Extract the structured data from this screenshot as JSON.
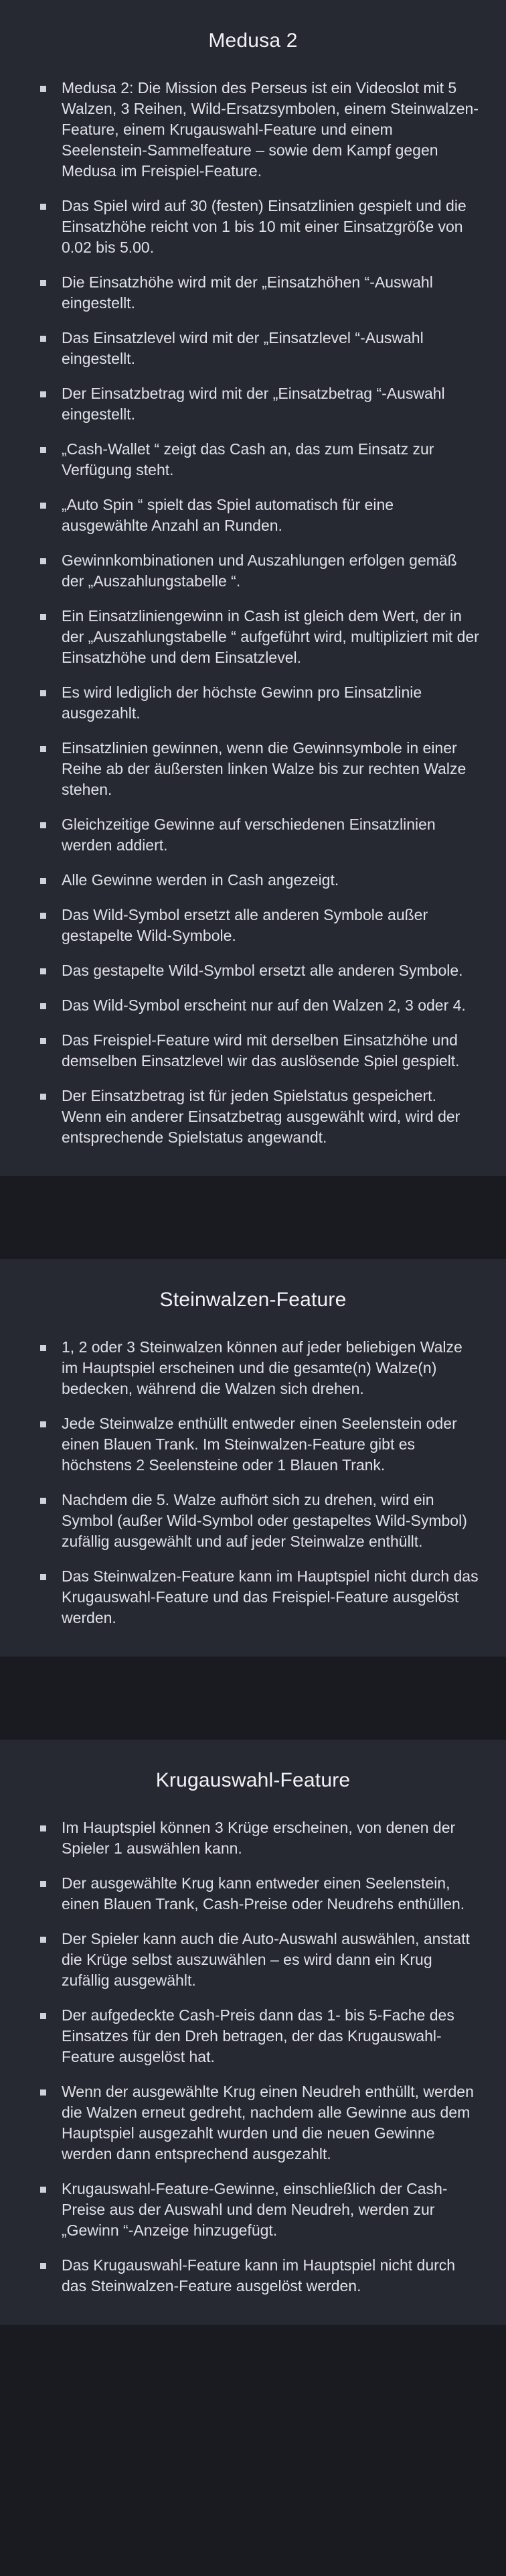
{
  "sections": [
    {
      "title": "Medusa 2",
      "items": [
        "Medusa 2: Die Mission des Perseus ist ein Videoslot mit 5 Walzen, 3 Reihen, Wild-Ersatzsymbolen, einem Steinwalzen-Feature, einem Krugauswahl-Feature und einem Seelenstein-Sammelfeature – sowie dem Kampf gegen Medusa im Freispiel-Feature.",
        "Das Spiel wird auf 30 (festen) Einsatzlinien gespielt und die Einsatzhöhe reicht von 1 bis 10 mit einer Einsatzgröße von 0.02 bis 5.00.",
        "Die Einsatzhöhe wird mit der „Einsatzhöhen “-Auswahl eingestellt.",
        "Das Einsatzlevel wird mit der „Einsatzlevel “-Auswahl eingestellt.",
        "Der Einsatzbetrag wird mit der „Einsatzbetrag “-Auswahl eingestellt.",
        "„Cash-Wallet “ zeigt das Cash an, das zum Einsatz zur Verfügung steht.",
        "„Auto Spin “ spielt das Spiel automatisch für eine ausgewählte Anzahl an Runden.",
        "Gewinnkombinationen und Auszahlungen erfolgen gemäß der „Auszahlungstabelle “.",
        "Ein Einsatzliniengewinn in Cash ist gleich dem Wert, der in der „Auszahlungstabelle “ aufgeführt wird, multipliziert mit der Einsatzhöhe und dem Einsatzlevel.",
        "Es wird lediglich der höchste Gewinn pro Einsatzlinie ausgezahlt.",
        "Einsatzlinien gewinnen, wenn die Gewinnsymbole in einer Reihe ab der äußersten linken Walze bis zur rechten Walze stehen.",
        "Gleichzeitige Gewinne auf verschiedenen Einsatzlinien werden addiert.",
        "Alle Gewinne werden in Cash angezeigt.",
        "Das Wild-Symbol ersetzt alle anderen Symbole außer gestapelte Wild-Symbole.",
        "Das gestapelte Wild-Symbol ersetzt alle anderen Symbole.",
        "Das Wild-Symbol erscheint nur auf den Walzen 2, 3 oder 4.",
        "Das Freispiel-Feature wird mit derselben Einsatzhöhe und demselben Einsatzlevel wir das auslösende Spiel gespielt.",
        "Der Einsatzbetrag ist für jeden Spielstatus gespeichert. Wenn ein anderer Einsatzbetrag ausgewählt wird, wird der entsprechende Spielstatus angewandt."
      ]
    },
    {
      "title": "Steinwalzen-Feature",
      "items": [
        "1, 2 oder 3 Steinwalzen können auf jeder beliebigen Walze im Hauptspiel erscheinen und die gesamte(n) Walze(n) bedecken, während die Walzen sich drehen.",
        "Jede Steinwalze enthüllt entweder einen Seelenstein oder einen Blauen Trank. Im Steinwalzen-Feature gibt es höchstens 2 Seelensteine oder 1 Blauen Trank.",
        "Nachdem die 5. Walze aufhört sich zu drehen, wird ein Symbol (außer Wild-Symbol oder gestapeltes Wild-Symbol) zufällig ausgewählt und auf jeder Steinwalze enthüllt.",
        "Das Steinwalzen-Feature kann im Hauptspiel nicht durch das Krugauswahl-Feature und das Freispiel-Feature ausgelöst werden."
      ]
    },
    {
      "title": "Krugauswahl-Feature",
      "items": [
        "Im Hauptspiel können 3 Krüge erscheinen, von denen der Spieler 1 auswählen kann.",
        "Der ausgewählte Krug kann entweder einen Seelenstein, einen Blauen Trank, Cash-Preise oder Neudrehs enthüllen.",
        "Der Spieler kann auch die Auto-Auswahl auswählen, anstatt die Krüge selbst auszuwählen – es wird dann ein Krug zufällig ausgewählt.",
        "Der aufgedeckte Cash-Preis dann das 1- bis 5-Fache des Einsatzes für den Dreh betragen, der das Krugauswahl-Feature ausgelöst hat.",
        "Wenn der ausgewählte Krug einen Neudreh enthüllt, werden die Walzen erneut gedreht, nachdem alle Gewinne aus dem Hauptspiel ausgezahlt wurden und die neuen Gewinne werden dann entsprechend ausgezahlt.",
        "Krugauswahl-Feature-Gewinne, einschließlich der Cash-Preise aus der Auswahl und dem Neudreh, werden zur „Gewinn “-Anzeige hinzugefügt.",
        "Das Krugauswahl-Feature kann im Hauptspiel nicht durch das Steinwalzen-Feature ausgelöst werden."
      ]
    }
  ]
}
